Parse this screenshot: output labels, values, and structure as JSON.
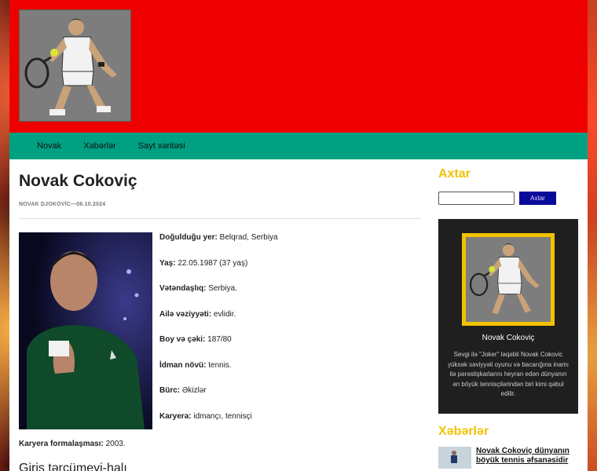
{
  "nav": {
    "items": [
      "Novak",
      "Xəbərlər",
      "Sayt xəritəsi"
    ]
  },
  "article": {
    "title": "Novak Cokoviç",
    "meta": "NOVAK DJOKOVİC—06.10.2024",
    "facts": [
      {
        "label": "Doğulduğu yer:",
        "value": " Belqrad, Serbiya"
      },
      {
        "label": "Yaş:",
        "value": " 22.05.1987 (37 yaş)"
      },
      {
        "label": "Vətəndaşlıq:",
        "value": " Serbiya."
      },
      {
        "label": "Ailə vəziyyəti:",
        "value": " evlidir."
      },
      {
        "label": "Boy və çəki:",
        "value": " 187/80"
      },
      {
        "label": "İdman növü:",
        "value": " tennis."
      },
      {
        "label": "Bürc:",
        "value": " Əkizlər"
      },
      {
        "label": "Karyera:",
        "value": " idmançı, tennisçi"
      }
    ],
    "career_form": {
      "label": "Karyera formalaşması:",
      "value": " 2003."
    },
    "subheading": "Giriş tərcümeyi-halı"
  },
  "sidebar": {
    "search_title": "Axtar",
    "search_placeholder": "",
    "search_button": "Axtar",
    "card_name": "Novak Cokoviç",
    "card_text": "Sevgi ilə \"Joker\" ləqəbli Novak Cokovic yüksək səviyyəli oyunu və bacarığına inamı ilə pərəstişkarlarını heyran edən dünyanın ən böyük tennisçilərindən biri kimi qəbul edilir.",
    "news_title": "Xəbərlər",
    "news": [
      {
        "title": "Novak Cokoviç dünyanın böyük tennis əfsanəsidir"
      }
    ]
  },
  "colors": {
    "header": "#ef0000",
    "nav": "#00a082",
    "accent": "#f2c200",
    "button": "#0a0a9a"
  }
}
